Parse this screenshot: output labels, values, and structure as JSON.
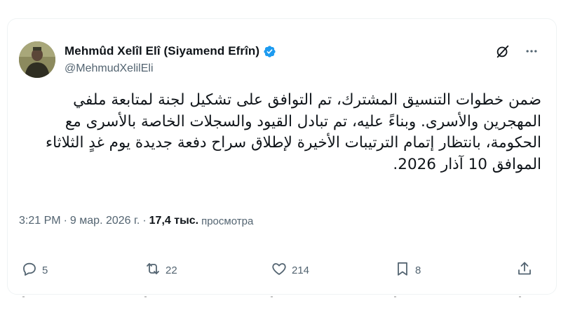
{
  "author": {
    "name": "Mehmûd Xelîl Elî (Siyamend Efrîn)",
    "handle": "@MehmudXelilEli",
    "verified": true
  },
  "tweet": {
    "text": "ضمن خطوات التنسيق المشترك، تم التوافق على تشكيل لجنة لمتابعة ملفي المهجرين والأسرى. وبناءً عليه، تم تبادل القيود والسجلات الخاصة بالأسرى مع الحكومة، بانتظار إتمام الترتيبات الأخيرة لإطلاق سراح دفعة جديدة يوم غدٍ الثلاثاء الموافق 10 آذار 2026."
  },
  "meta": {
    "time": "3:21 PM",
    "separator": "·",
    "date": "9 мар. 2026 г.",
    "views_count": "17,4 тыс.",
    "views_label": "просмотра"
  },
  "actions": {
    "replies": "5",
    "reposts": "22",
    "likes": "214",
    "bookmarks": "8"
  },
  "colors": {
    "text_primary": "#0f1419",
    "text_secondary": "#536471",
    "verified_blue": "#1d9bf0",
    "border": "#eff3f4"
  },
  "icons": [
    "grok-icon",
    "more-icon",
    "reply-icon",
    "repost-icon",
    "like-icon",
    "bookmark-icon",
    "share-icon",
    "verified-badge-icon"
  ]
}
